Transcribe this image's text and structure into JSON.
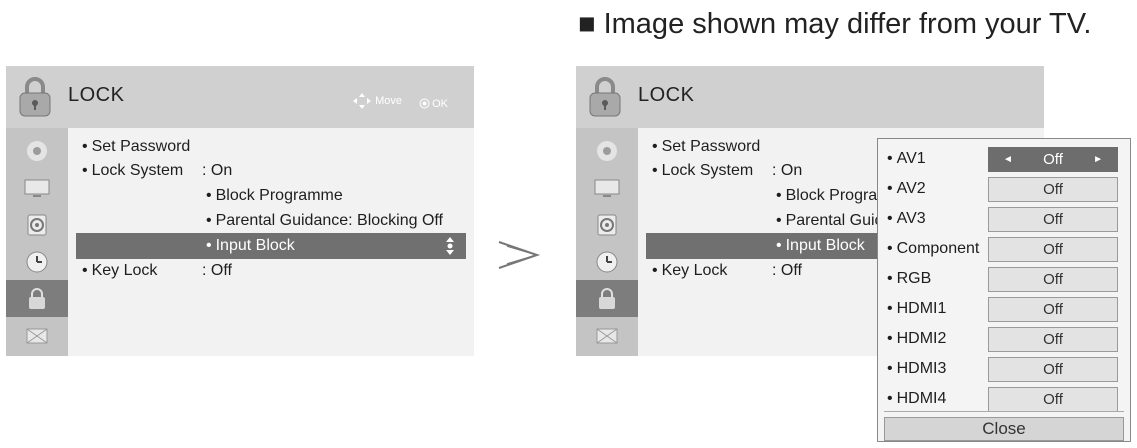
{
  "note": {
    "square": "■",
    "text": "Image shown may differ from your TV."
  },
  "menu": {
    "title": "LOCK",
    "nav_move": "Move",
    "nav_ok": "OK",
    "items": {
      "set_password": "Set Password",
      "lock_system": "Lock System",
      "lock_system_value": ": On",
      "block_programme": "Block Programme",
      "parental_guidance": "Parental Guidance: Blocking Off",
      "input_block": "Input Block",
      "key_lock": "Key Lock",
      "key_lock_value": ": Off"
    },
    "items_truncated": {
      "block_programme": "Block Progra",
      "parental_guidance": "Parental Guic"
    },
    "sidebar_icons": [
      "setup-icon",
      "picture-icon",
      "audio-icon",
      "time-icon",
      "lock-icon",
      "usb-icon"
    ],
    "active_sidebar_index": 4
  },
  "input_block_popup": {
    "inputs": [
      {
        "label": "AV1",
        "value": "Off",
        "selected": true
      },
      {
        "label": "AV2",
        "value": "Off"
      },
      {
        "label": "AV3",
        "value": "Off"
      },
      {
        "label": "Component",
        "value": "Off"
      },
      {
        "label": "RGB",
        "value": "Off"
      },
      {
        "label": "HDMI1",
        "value": "Off"
      },
      {
        "label": "HDMI2",
        "value": "Off"
      },
      {
        "label": "HDMI3",
        "value": "Off"
      },
      {
        "label": "HDMI4",
        "value": "Off"
      }
    ],
    "selected_left_arrow": "◄",
    "selected_right_arrow": "►",
    "close_label": "Close"
  },
  "colors": {
    "panel_bg": "#d9d9d9",
    "content_bg": "#f2f2f2",
    "highlight": "#707070"
  }
}
